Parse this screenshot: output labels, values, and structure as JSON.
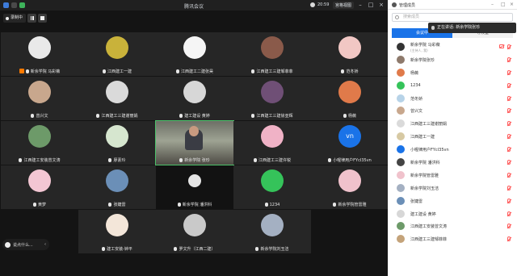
{
  "window": {
    "title": "腾讯会议",
    "time": "20:59",
    "view_label": "宫格视图"
  },
  "recording": {
    "label": "录制中"
  },
  "tiles": [
    {
      "name": "",
      "avatar_color": "#e9e9e9"
    },
    {
      "name": "",
      "avatar_color": "#c9b23a"
    },
    {
      "name": "",
      "avatar_color": "#f5f5f5"
    },
    {
      "name": "",
      "avatar_color": "#8a5a4a"
    },
    {
      "name": "",
      "avatar_color": "#f1c7c4"
    },
    {
      "name": "新余学院 马彩薇",
      "avatar_color": "#333333",
      "host": true
    },
    {
      "name": "江西建工一建",
      "avatar_color": "#d7c9a3"
    },
    {
      "name": "江西建工二建张昊",
      "avatar_color": "#efefef"
    },
    {
      "name": "江西建工三建邹菲菲",
      "avatar_color": "#c4a37a"
    },
    {
      "name": "范冬娇",
      "avatar_color": "#b7d3e8"
    },
    {
      "name": "曾兴文",
      "avatar_color": "#c8a78d"
    },
    {
      "name": "江西建工三建谢丽娟",
      "avatar_color": "#dadada"
    },
    {
      "name": "建工建设 黄婷",
      "avatar_color": "#d7d7d7"
    },
    {
      "name": "江西建工三建徐亚辉",
      "avatar_color": "#6f4f76"
    },
    {
      "name": "杨薇",
      "avatar_color": "#e07a4a"
    },
    {
      "name": "江西建工安装曾文涛",
      "avatar_color": "#6d9a69"
    },
    {
      "name": "廖素玲",
      "avatar_color": "#d6e6cf"
    },
    {
      "name": "新余学院 张珍",
      "avatar_color": "",
      "video": true
    },
    {
      "name": "江西建工三建许锐",
      "avatar_color": "#f0b2c6"
    },
    {
      "name": "小喔律用户FYcI35vn",
      "avatar_color": "",
      "vn": true,
      "vn_text": "vn"
    },
    {
      "name": "黄梦",
      "avatar_color": "#f3c6d3"
    },
    {
      "name": "张婕雷",
      "avatar_color": "#6b8fb7"
    },
    {
      "name": "新余学院 潘洪科",
      "avatar_color": "",
      "dark": true
    },
    {
      "name": "1234",
      "avatar_color": "#35c35a"
    },
    {
      "name": "新余学院管雷雅",
      "avatar_color": "#f0c2cc"
    },
    {
      "name": "建工安装-钟平",
      "avatar_color": "#f3e6d9"
    },
    {
      "name": "罗文升（江西二建）",
      "avatar_color": "#c9c9c9"
    },
    {
      "name": "新余学院刘玉洁",
      "avatar_color": "#a4b0c2"
    }
  ],
  "chat_mini": {
    "label": "说点什么..."
  },
  "panel": {
    "title": "管理成员",
    "search_placeholder": "搜索成员",
    "toast": "正在讲话: 新余学院张珍",
    "tabs": [
      "会议中",
      "等候室"
    ],
    "members": [
      {
        "name": "新余学院 马彩薇",
        "sub": "(主持人, 我)",
        "avatar_color": "#333333",
        "cam_off": true,
        "mic_off": true
      },
      {
        "name": "新余学院张珍",
        "avatar_color": "#8e7a6c",
        "mic_off": true
      },
      {
        "name": "杨薇",
        "avatar_color": "#e07a4a",
        "mic_off": true
      },
      {
        "name": "1234",
        "avatar_color": "#35c35a",
        "mic_off": true
      },
      {
        "name": "范冬娇",
        "avatar_color": "#b7d3e8",
        "mic_off": true
      },
      {
        "name": "曾兴文",
        "avatar_color": "#c8a78d",
        "mic_off": true
      },
      {
        "name": "江西建工三建谢丽娟",
        "avatar_color": "#dadada",
        "mic_off": true
      },
      {
        "name": "江西建工一建",
        "avatar_color": "#d7c9a3",
        "mic_off": true
      },
      {
        "name": "小喔律用户FYcI35vn",
        "avatar_color": "#1a73e8",
        "mic_off": true
      },
      {
        "name": "新余学院 潘洪科",
        "avatar_color": "#444444",
        "mic_off": true
      },
      {
        "name": "新余学院管雷雅",
        "avatar_color": "#f0c2cc",
        "mic_off": true
      },
      {
        "name": "新余学院刘玉洁",
        "avatar_color": "#a4b0c2",
        "mic_off": true
      },
      {
        "name": "张婕雷",
        "avatar_color": "#6b8fb7",
        "mic_off": true
      },
      {
        "name": "建工建设 黄婷",
        "avatar_color": "#d7d7d7",
        "mic_off": true
      },
      {
        "name": "江西建工安装曾文涛",
        "avatar_color": "#6d9a69",
        "mic_off": true
      },
      {
        "name": "江西建工三建邹菲菲",
        "avatar_color": "#c4a37a",
        "mic_off": true
      }
    ]
  }
}
